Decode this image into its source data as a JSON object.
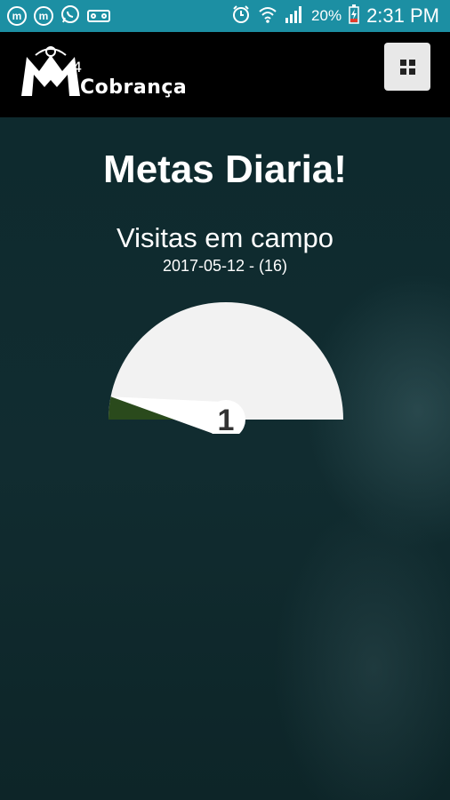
{
  "status_bar": {
    "notification_icons": [
      "messenger-m-icon",
      "messenger-m-icon",
      "whatsapp-icon",
      "voicemail-icon"
    ],
    "battery_percent": "20%",
    "time": "2:31 PM"
  },
  "header": {
    "logo_digit": "4",
    "logo_text": "Cobrança",
    "menu_icon": "grid-icon"
  },
  "main": {
    "title": "Metas Diaria!",
    "subtitle": "Visitas em campo",
    "date_line": "2017-05-12 - (16)"
  },
  "gauge": {
    "value_label": "1",
    "value": 1,
    "max": 16,
    "colors": {
      "track": "#f2f2f2",
      "fill": "#2a4a1c",
      "needle": "#ffffff"
    }
  }
}
